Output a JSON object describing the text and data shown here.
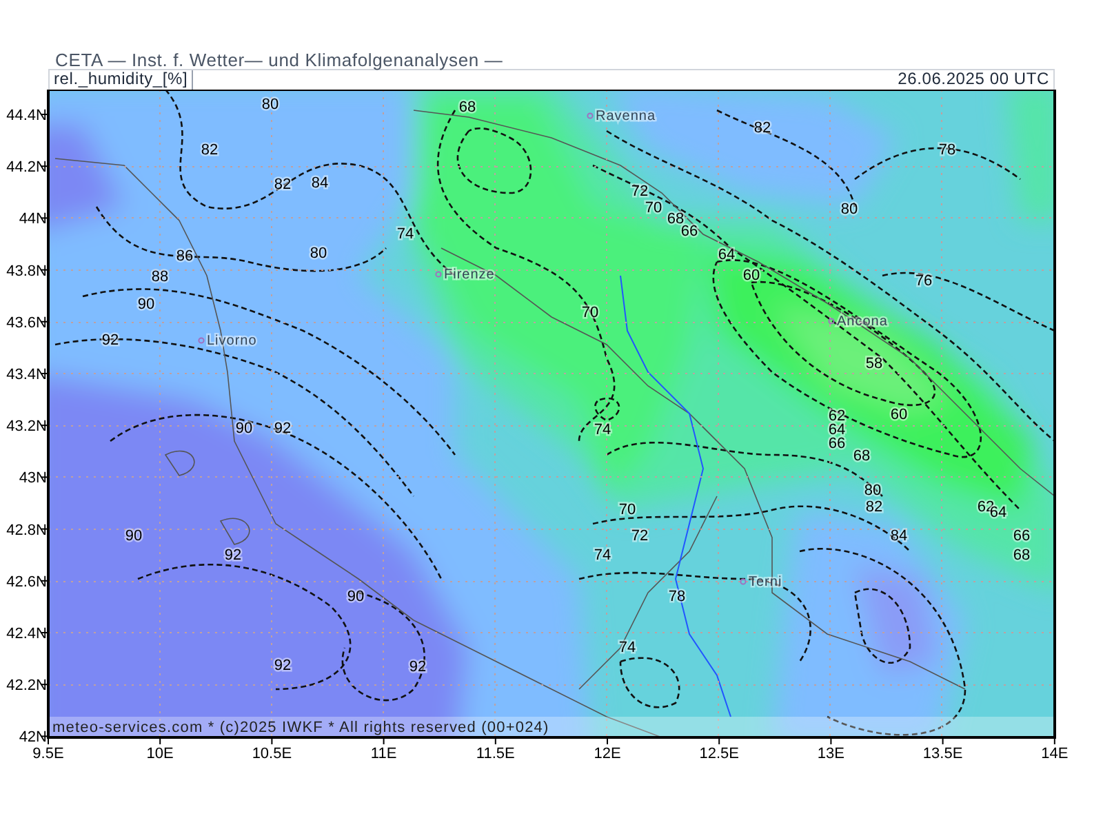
{
  "header": {
    "title": "CETA — Inst. f. Wetter— und Klimafolgenanalysen —"
  },
  "panel": {
    "variable": "rel._humidity_[%]",
    "valid_time": "26.06.2025 00 UTC"
  },
  "map": {
    "y_ticks": [
      "44.4N",
      "44.2N",
      "44N",
      "43.8N",
      "43.6N",
      "43.4N",
      "43.2N",
      "43N",
      "42.8N",
      "42.6N",
      "42.4N",
      "42.2N",
      "42N"
    ],
    "x_ticks": [
      "9.5E",
      "10E",
      "10.5E",
      "11E",
      "11.5E",
      "12E",
      "12.5E",
      "13E",
      "13.5E",
      "14E"
    ],
    "cities": [
      {
        "name": "Ravenna"
      },
      {
        "name": "Firenze"
      },
      {
        "name": "Livorno"
      },
      {
        "name": "Ancona"
      },
      {
        "name": "Terni"
      }
    ],
    "contour_labels": [
      "80",
      "68",
      "82",
      "82",
      "78",
      "82",
      "84",
      "72",
      "70",
      "80",
      "68",
      "66",
      "74",
      "86",
      "80",
      "64",
      "88",
      "60",
      "76",
      "90",
      "70",
      "92",
      "58",
      "62",
      "60",
      "90",
      "92",
      "74",
      "64",
      "66",
      "68",
      "80",
      "70",
      "82",
      "62",
      "64",
      "90",
      "72",
      "84",
      "66",
      "92",
      "74",
      "68",
      "90",
      "78",
      "74",
      "92",
      "92"
    ],
    "credit": "meteo-services.com * (c)2025 IWKF * All rights reserved (00+024)"
  }
}
